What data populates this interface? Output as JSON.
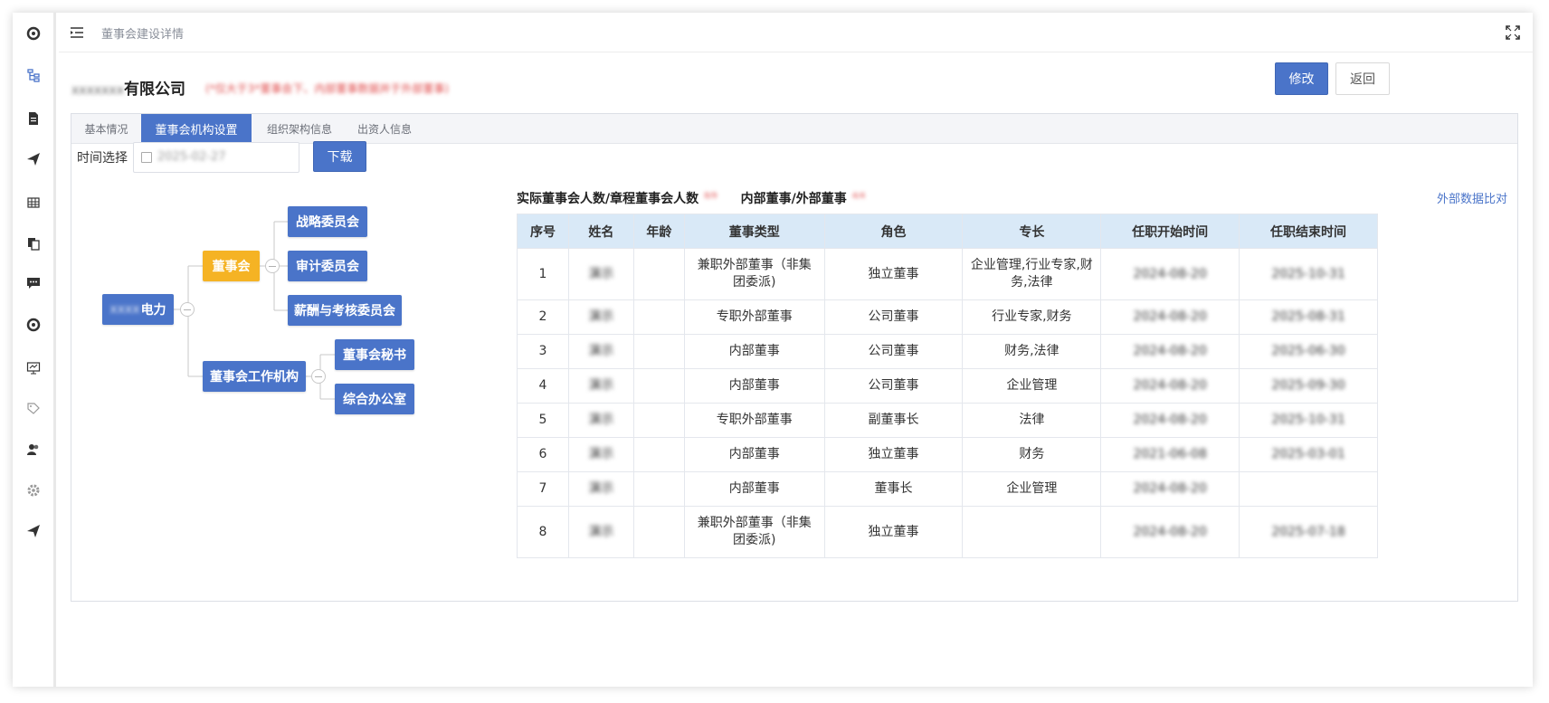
{
  "sidebar": {
    "icons": [
      "settings-icon",
      "tree-icon",
      "document-icon",
      "send-icon",
      "grid-icon",
      "copy-icon",
      "chat-icon",
      "settings-icon",
      "monitor-icon",
      "tag-icon",
      "users-icon",
      "gear-icon",
      "send-icon"
    ]
  },
  "header": {
    "breadcrumb": "董事会建设详情"
  },
  "company": {
    "name_prefix": "xxxxxxx",
    "name": "有限公司",
    "note": "(*仅大于3*董事会下、内部董事数据并于外部董事)"
  },
  "actions": {
    "edit_label": "修改",
    "back_label": "返回"
  },
  "tabs": [
    {
      "label": "基本情况",
      "active": false
    },
    {
      "label": "董事会机构设置",
      "active": true
    },
    {
      "label": "组织架构信息",
      "active": false
    },
    {
      "label": "出资人信息",
      "active": false
    }
  ],
  "filter": {
    "time_label": "时间选择",
    "date_value": "2025-02-27",
    "download_label": "下载"
  },
  "org_chart": {
    "root_prefix": "xxxx",
    "root": "电力",
    "board": "董事会",
    "committees": [
      "战略委员会",
      "审计委员会",
      "薪酬与考核委员会"
    ],
    "work_org": "董事会工作机构",
    "work_units": [
      "董事会秘书",
      "综合办公室"
    ]
  },
  "summary": {
    "actual_vs_charter_label": "实际董事会人数/章程董事会人数",
    "actual_vs_charter_value": "8/9",
    "internal_vs_external_label": "内部董事/外部董事",
    "internal_vs_external_value": "4/4",
    "external_compare_link": "外部数据比对"
  },
  "table": {
    "headers": [
      "序号",
      "姓名",
      "年龄",
      "董事类型",
      "角色",
      "专长",
      "任职开始时间",
      "任职结束时间"
    ],
    "rows": [
      {
        "no": "1",
        "name": "演示",
        "age": "",
        "type": "兼职外部董事（非集团委派)",
        "role": "独立董事",
        "expertise": "企业管理,行业专家,财务,法律",
        "start": "2024-08-20",
        "end": "2025-10-31"
      },
      {
        "no": "2",
        "name": "演示",
        "age": "",
        "type": "专职外部董事",
        "role": "公司董事",
        "expertise": "行业专家,财务",
        "start": "2024-08-20",
        "end": "2025-08-31"
      },
      {
        "no": "3",
        "name": "演示",
        "age": "",
        "type": "内部董事",
        "role": "公司董事",
        "expertise": "财务,法律",
        "start": "2024-08-20",
        "end": "2025-06-30"
      },
      {
        "no": "4",
        "name": "演示",
        "age": "",
        "type": "内部董事",
        "role": "公司董事",
        "expertise": "企业管理",
        "start": "2024-08-20",
        "end": "2025-09-30"
      },
      {
        "no": "5",
        "name": "演示",
        "age": "",
        "type": "专职外部董事",
        "role": "副董事长",
        "expertise": "法律",
        "start": "2024-08-20",
        "end": "2025-10-31"
      },
      {
        "no": "6",
        "name": "演示",
        "age": "",
        "type": "内部董事",
        "role": "独立董事",
        "expertise": "财务",
        "start": "2021-06-08",
        "end": "2025-03-01"
      },
      {
        "no": "7",
        "name": "演示",
        "age": "",
        "type": "内部董事",
        "role": "董事长",
        "expertise": "企业管理",
        "start": "2024-08-20",
        "end": ""
      },
      {
        "no": "8",
        "name": "演示",
        "age": "",
        "type": "兼职外部董事（非集团委派)",
        "role": "独立董事",
        "expertise": "",
        "start": "2024-08-20",
        "end": "2025-07-18"
      }
    ]
  },
  "colors": {
    "primary": "#4a74c9",
    "gold": "#f5b324",
    "table_header": "#d9e9f7",
    "note_red": "#e04b4b"
  }
}
